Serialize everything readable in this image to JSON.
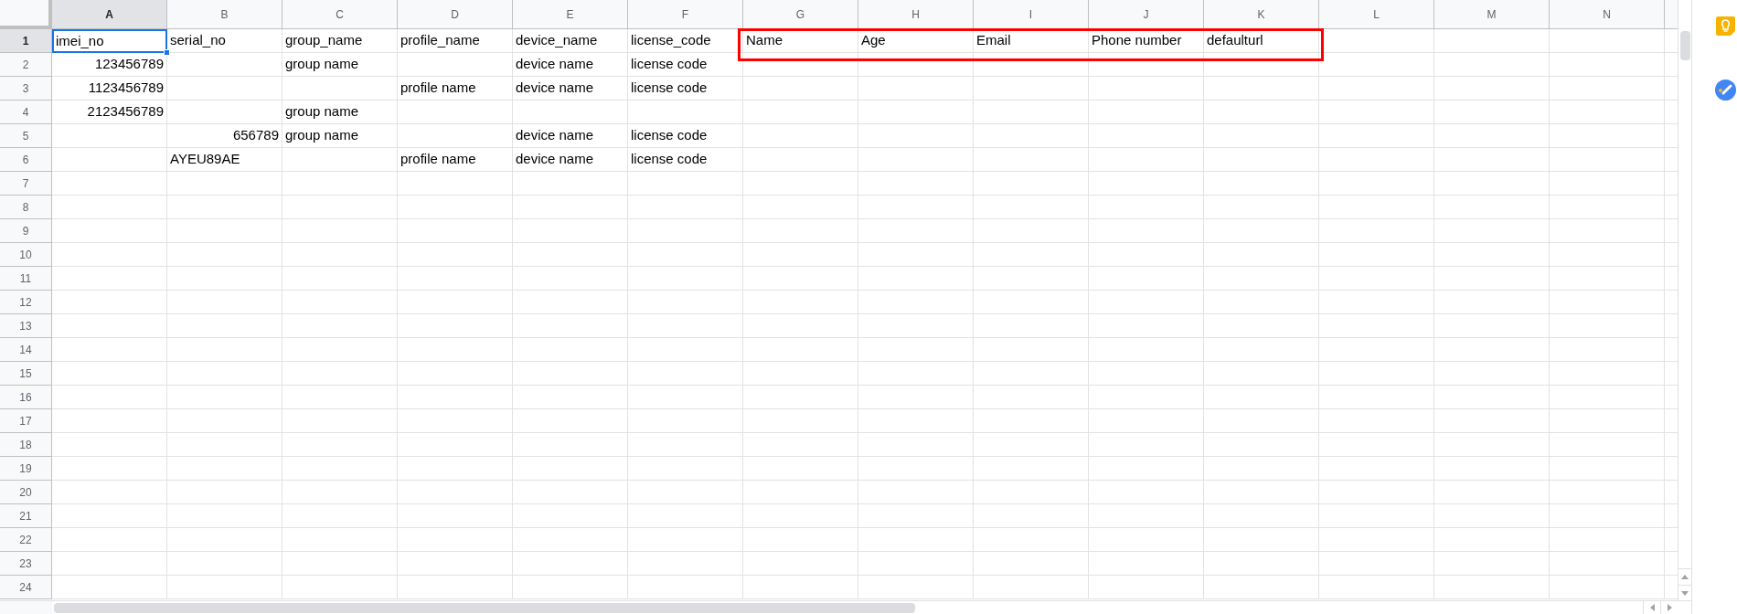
{
  "columns": [
    {
      "label": "A",
      "selected": true
    },
    {
      "label": "B",
      "selected": false
    },
    {
      "label": "C",
      "selected": false
    },
    {
      "label": "D",
      "selected": false
    },
    {
      "label": "E",
      "selected": false
    },
    {
      "label": "F",
      "selected": false
    },
    {
      "label": "G",
      "selected": false
    },
    {
      "label": "H",
      "selected": false
    },
    {
      "label": "I",
      "selected": false
    },
    {
      "label": "J",
      "selected": false
    },
    {
      "label": "K",
      "selected": false
    },
    {
      "label": "L",
      "selected": false
    },
    {
      "label": "M",
      "selected": false
    },
    {
      "label": "N",
      "selected": false
    }
  ],
  "rows": [
    {
      "number": "1",
      "selected": true,
      "cells": [
        {
          "kind": "text",
          "text": "imei_no",
          "selected": true,
          "highlighted": false
        },
        {
          "kind": "text",
          "text": "serial_no",
          "selected": false,
          "highlighted": false
        },
        {
          "kind": "text",
          "text": "group_name",
          "selected": false,
          "highlighted": false
        },
        {
          "kind": "text",
          "text": "profile_name",
          "selected": false,
          "highlighted": false
        },
        {
          "kind": "text",
          "text": "device_name",
          "selected": false,
          "highlighted": false
        },
        {
          "kind": "text",
          "text": "license_code",
          "selected": false,
          "highlighted": false
        },
        {
          "kind": "text",
          "text": "Name",
          "selected": false,
          "highlighted": true
        },
        {
          "kind": "text",
          "text": "Age",
          "selected": false,
          "highlighted": true
        },
        {
          "kind": "text",
          "text": "Email",
          "selected": false,
          "highlighted": true
        },
        {
          "kind": "text",
          "text": "Phone number",
          "selected": false,
          "highlighted": true
        },
        {
          "kind": "text",
          "text": "defaulturl",
          "selected": false,
          "highlighted": true
        }
      ]
    },
    {
      "number": "2",
      "selected": false,
      "cells": [
        {
          "kind": "number",
          "text": "123456789",
          "selected": false,
          "highlighted": false
        },
        {
          "kind": "empty",
          "selected": false,
          "highlighted": false
        },
        {
          "kind": "text",
          "text": "group name",
          "selected": false,
          "highlighted": false
        },
        {
          "kind": "empty",
          "selected": false,
          "highlighted": false
        },
        {
          "kind": "text",
          "text": "device name",
          "selected": false,
          "highlighted": false
        },
        {
          "kind": "text",
          "text": "license code",
          "selected": false,
          "highlighted": false
        }
      ]
    },
    {
      "number": "3",
      "selected": false,
      "cells": [
        {
          "kind": "number",
          "text": "1123456789",
          "selected": false,
          "highlighted": false
        },
        {
          "kind": "empty",
          "selected": false,
          "highlighted": false
        },
        {
          "kind": "empty",
          "selected": false,
          "highlighted": false
        },
        {
          "kind": "text",
          "text": "profile name",
          "selected": false,
          "highlighted": false
        },
        {
          "kind": "text",
          "text": "device name",
          "selected": false,
          "highlighted": false
        },
        {
          "kind": "text",
          "text": "license code",
          "selected": false,
          "highlighted": false
        }
      ]
    },
    {
      "number": "4",
      "selected": false,
      "cells": [
        {
          "kind": "number",
          "text": "2123456789",
          "selected": false,
          "highlighted": false
        },
        {
          "kind": "empty",
          "selected": false,
          "highlighted": false
        },
        {
          "kind": "text",
          "text": "group name",
          "selected": false,
          "highlighted": false
        }
      ]
    },
    {
      "number": "5",
      "selected": false,
      "cells": [
        {
          "kind": "empty",
          "selected": false,
          "highlighted": false
        },
        {
          "kind": "number",
          "text": "656789",
          "selected": false,
          "highlighted": false
        },
        {
          "kind": "text",
          "text": "group name",
          "selected": false,
          "highlighted": false
        },
        {
          "kind": "empty",
          "selected": false,
          "highlighted": false
        },
        {
          "kind": "text",
          "text": "device name",
          "selected": false,
          "highlighted": false
        },
        {
          "kind": "text",
          "text": "license code",
          "selected": false,
          "highlighted": false
        }
      ]
    },
    {
      "number": "6",
      "selected": false,
      "cells": [
        {
          "kind": "empty",
          "selected": false,
          "highlighted": false
        },
        {
          "kind": "text",
          "text": "AYEU89AE",
          "selected": false,
          "highlighted": false
        },
        {
          "kind": "empty",
          "selected": false,
          "highlighted": false
        },
        {
          "kind": "text",
          "text": "profile name",
          "selected": false,
          "highlighted": false
        },
        {
          "kind": "text",
          "text": "device name",
          "selected": false,
          "highlighted": false
        },
        {
          "kind": "text",
          "text": "license code",
          "selected": false,
          "highlighted": false
        }
      ]
    },
    {
      "number": "7",
      "selected": false,
      "cells": []
    },
    {
      "number": "8",
      "selected": false,
      "cells": []
    },
    {
      "number": "9",
      "selected": false,
      "cells": []
    },
    {
      "number": "10",
      "selected": false,
      "cells": []
    },
    {
      "number": "11",
      "selected": false,
      "cells": []
    },
    {
      "number": "12",
      "selected": false,
      "cells": []
    },
    {
      "number": "13",
      "selected": false,
      "cells": []
    },
    {
      "number": "14",
      "selected": false,
      "cells": []
    },
    {
      "number": "15",
      "selected": false,
      "cells": []
    },
    {
      "number": "16",
      "selected": false,
      "cells": []
    },
    {
      "number": "17",
      "selected": false,
      "cells": []
    },
    {
      "number": "18",
      "selected": false,
      "cells": []
    },
    {
      "number": "19",
      "selected": false,
      "cells": []
    },
    {
      "number": "20",
      "selected": false,
      "cells": []
    },
    {
      "number": "21",
      "selected": false,
      "cells": []
    },
    {
      "number": "22",
      "selected": false,
      "cells": []
    },
    {
      "number": "23",
      "selected": false,
      "cells": []
    },
    {
      "number": "24",
      "selected": false,
      "cells": []
    }
  ]
}
